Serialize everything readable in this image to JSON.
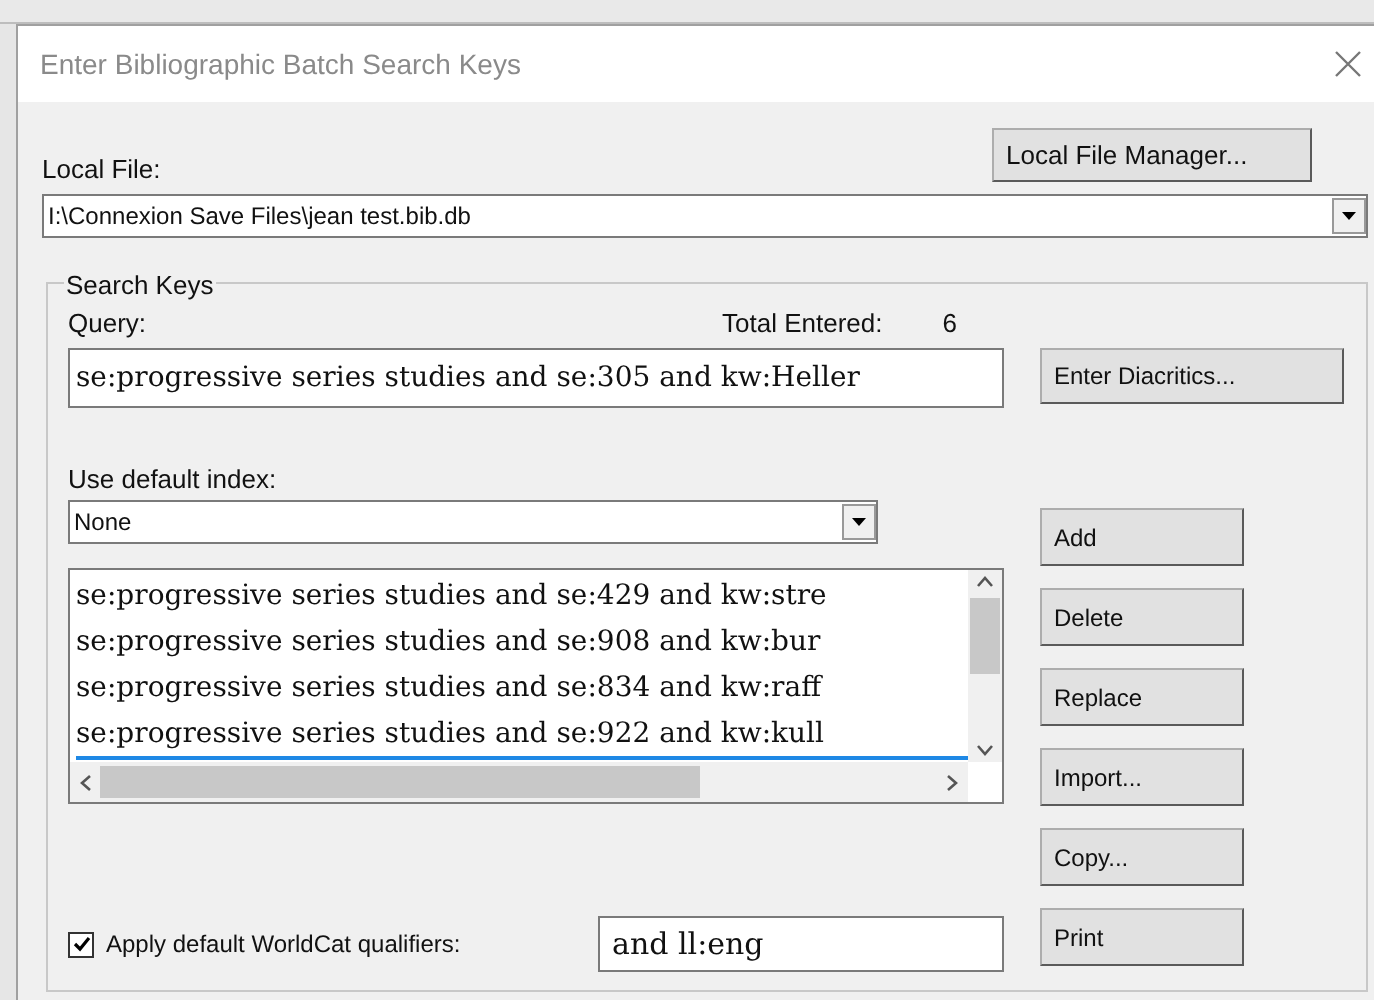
{
  "window": {
    "title": "Enter Bibliographic Batch Search Keys"
  },
  "local_file": {
    "label": "Local File:",
    "value": "I:\\Connexion Save Files\\jean test.bib.db",
    "manager_button": "Local File Manager..."
  },
  "search_keys": {
    "title": "Search Keys",
    "query_label": "Query:",
    "total_label": "Total Entered:",
    "total": "6",
    "query": "se:progressive series studies and se:305 and kw:Heller",
    "diacritics_button": "Enter Diacritics...",
    "index_label": "Use default index:",
    "index_value": "None",
    "keys": [
      {
        "text": "se:progressive series studies and se:429 and kw:stre",
        "selected": false
      },
      {
        "text": "se:progressive series studies and se:908 and kw:bur",
        "selected": false
      },
      {
        "text": "se:progressive series studies and se:834 and kw:raff",
        "selected": false
      },
      {
        "text": "se:progressive series studies and se:922 and kw:kull",
        "selected": true
      }
    ],
    "buttons": [
      "Add",
      "Delete",
      "Replace",
      "Import...",
      "Copy...",
      "Print"
    ],
    "qualifiers": {
      "label": "Apply default WorldCat qualifiers:",
      "checked": true,
      "value": "and ll:eng"
    }
  }
}
